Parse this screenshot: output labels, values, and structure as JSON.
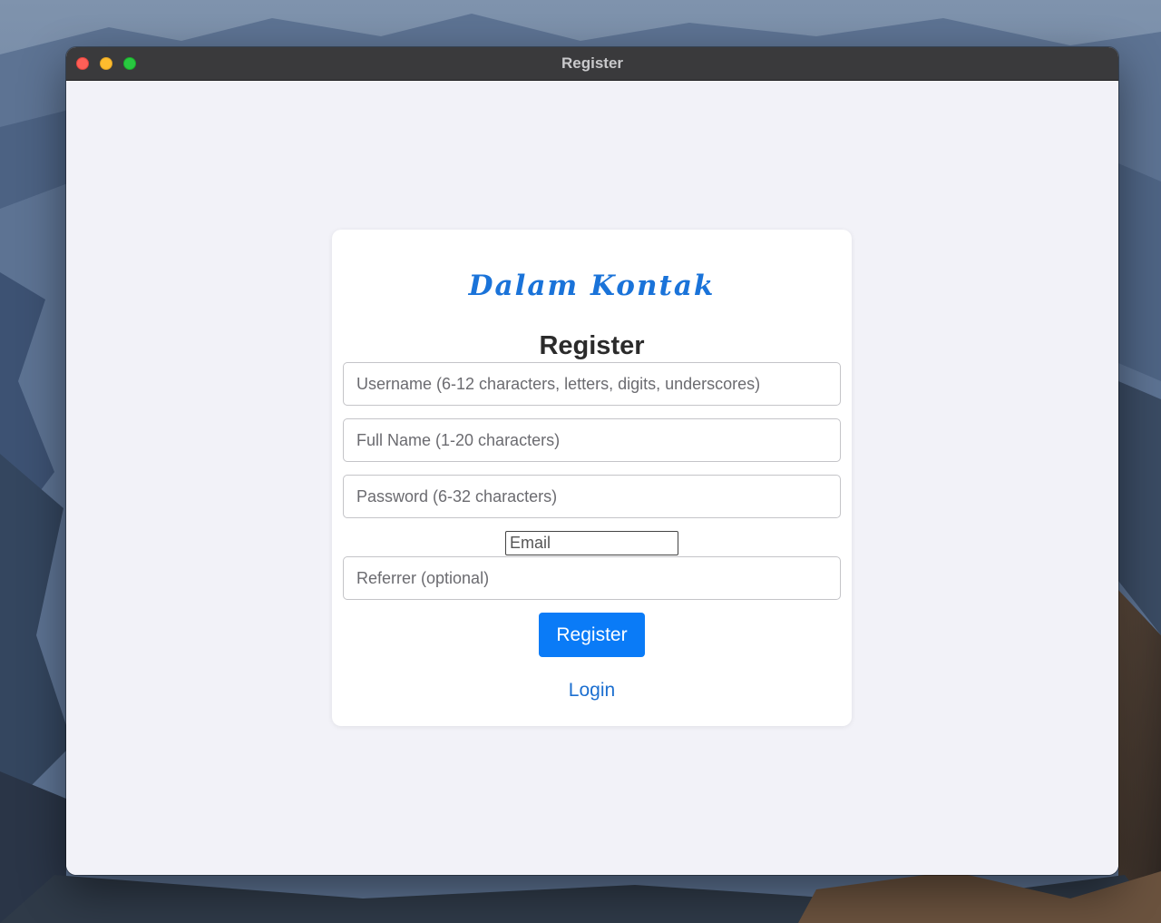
{
  "window": {
    "title": "Register"
  },
  "brand": {
    "name": "Dalam Kontak"
  },
  "form": {
    "heading": "Register",
    "username_placeholder": "Username (6-12 characters, letters, digits, underscores)",
    "fullname_placeholder": "Full Name (1-20 characters)",
    "password_placeholder": "Password (6-32 characters)",
    "email_placeholder": "Email",
    "referrer_placeholder": "Referrer (optional)",
    "submit_label": "Register",
    "login_link": "Login"
  },
  "colors": {
    "accent": "#0a7bf7",
    "brand": "#1a73d9",
    "link": "#1c6fd0",
    "page_background": "#f2f2f8",
    "titlebar": "#3a3a3c"
  }
}
